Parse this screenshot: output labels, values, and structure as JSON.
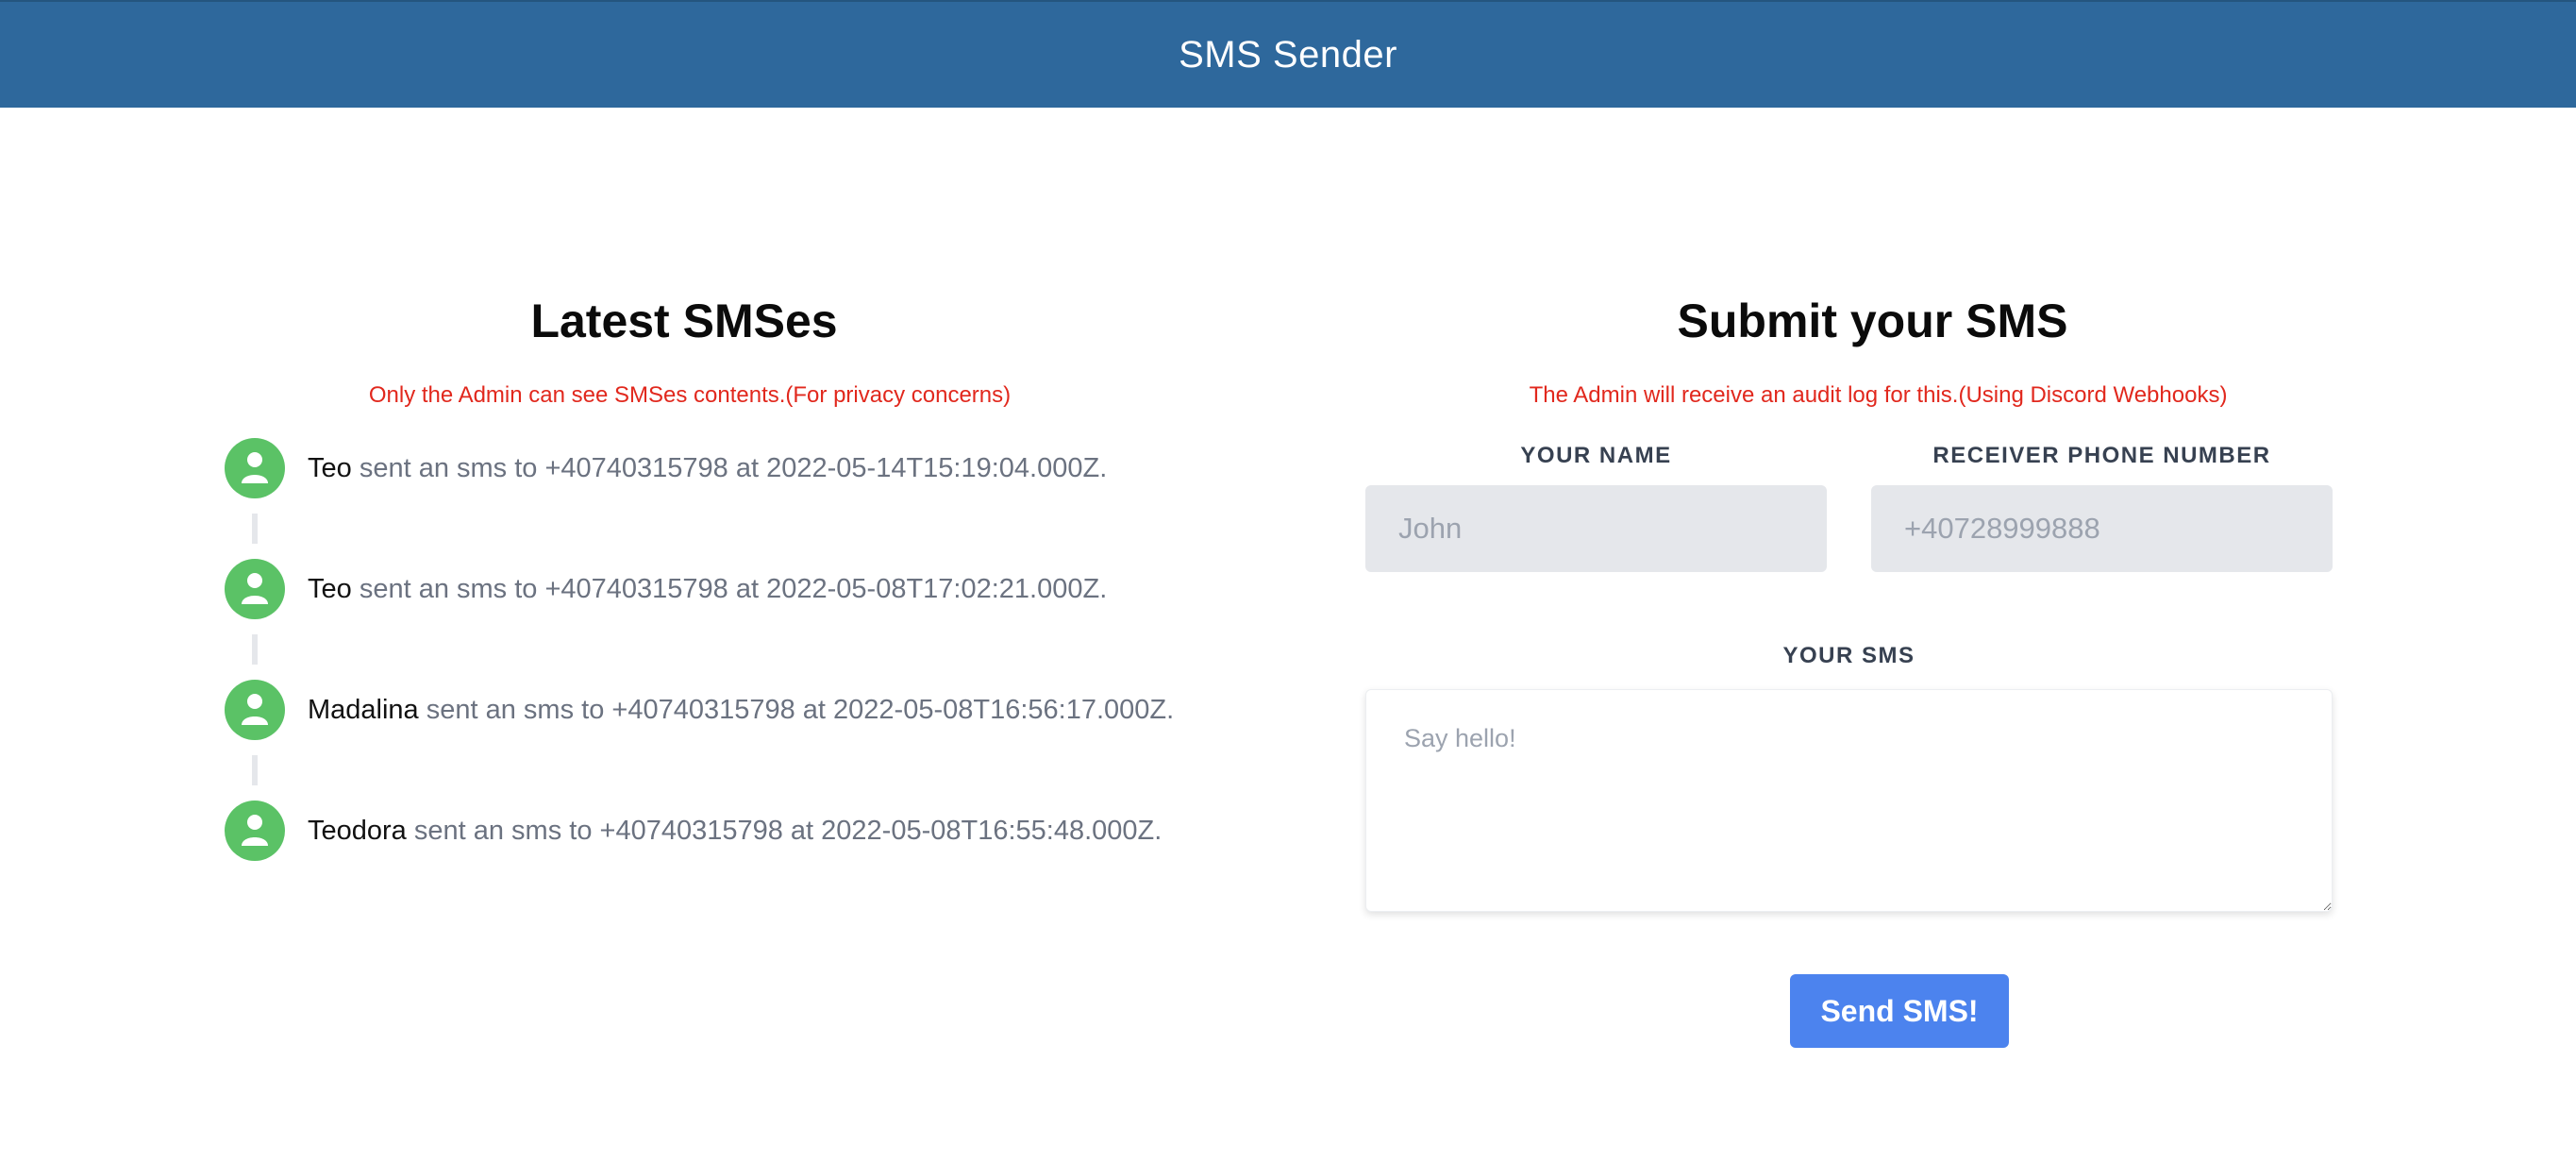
{
  "header": {
    "title": "SMS Sender"
  },
  "latest": {
    "title": "Latest SMSes",
    "warning": "Only the Admin can see SMSes contents.(For privacy concerns)",
    "items": [
      {
        "name": "Teo",
        "text": " sent an sms to +40740315798 at 2022-05-14T15:19:04.000Z.",
        "icon": "user-icon"
      },
      {
        "name": "Teo",
        "text": " sent an sms to +40740315798 at 2022-05-08T17:02:21.000Z.",
        "icon": "user-icon"
      },
      {
        "name": "Madalina",
        "text": " sent an sms to +40740315798 at 2022-05-08T16:56:17.000Z.",
        "icon": "user-icon"
      },
      {
        "name": "Teodora",
        "text": " sent an sms to +40740315798 at 2022-05-08T16:55:48.000Z.",
        "icon": "user-icon"
      }
    ]
  },
  "form": {
    "title": "Submit your SMS",
    "warning": "The Admin will receive an audit log for this.(Using Discord Webhooks)",
    "name_label": "YOUR NAME",
    "name_placeholder": "John",
    "name_value": "",
    "phone_label": "RECEIVER PHONE NUMBER",
    "phone_placeholder": "+40728999888",
    "phone_value": "",
    "sms_label": "YOUR SMS",
    "sms_placeholder": "Say hello!",
    "sms_value": "",
    "send_label": "Send SMS!"
  },
  "colors": {
    "header_bg": "#2e689c",
    "avatar_bg": "#5bc266",
    "warning": "#e1281d",
    "button_bg": "#4c83ee"
  }
}
